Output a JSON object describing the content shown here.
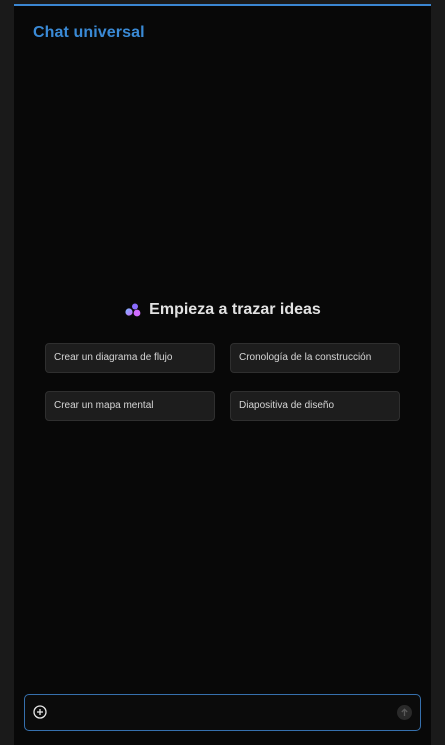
{
  "header": {
    "title": "Chat universal"
  },
  "empty_state": {
    "icon": "sparkle-dots-icon",
    "heading": "Empieza a trazar ideas"
  },
  "suggestions": [
    {
      "label": "Crear un diagrama de flujo"
    },
    {
      "label": "Cronología de la construcción"
    },
    {
      "label": "Crear un mapa mental"
    },
    {
      "label": "Diapositiva de diseño"
    }
  ],
  "composer": {
    "placeholder": "",
    "add_icon": "plus-circle-icon",
    "send_icon": "arrow-up-icon"
  },
  "colors": {
    "accent": "#3a8ad6",
    "background": "#080808",
    "chip_background": "#1d1d1d"
  }
}
